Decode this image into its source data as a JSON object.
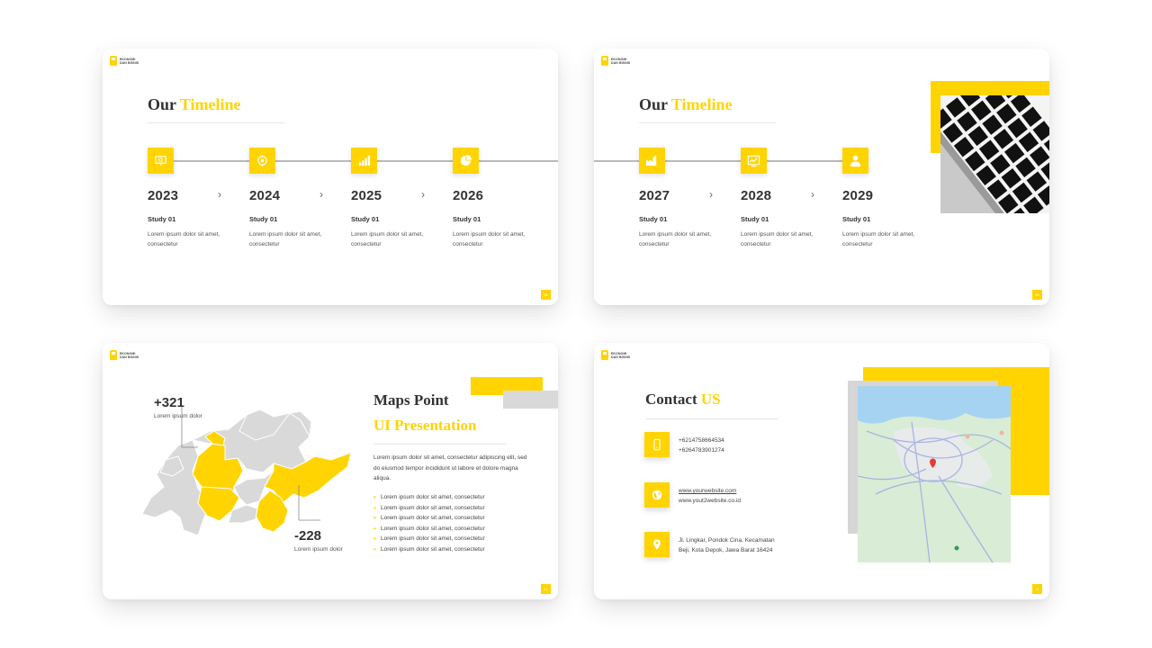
{
  "brand": {
    "logo_line1": "EKONOMI",
    "logo_line2": "DAN BISNIS",
    "primary": "#FFD400",
    "text": "#333333"
  },
  "slide1": {
    "title_main": "Our",
    "title_accent": "Timeline",
    "page": "08",
    "items": [
      {
        "year": "2023",
        "study": "Study 01",
        "desc": "Lorem ipsum dolor sit amet, consectetur",
        "icon": "presentation-icon"
      },
      {
        "year": "2024",
        "study": "Study 01",
        "desc": "Lorem ipsum dolor sit amet, consectetur",
        "icon": "target-icon"
      },
      {
        "year": "2025",
        "study": "Study 01",
        "desc": "Lorem ipsum dolor sit amet, consectetur",
        "icon": "bar-chart-icon"
      },
      {
        "year": "2026",
        "study": "Study 01",
        "desc": "Lorem ipsum dolor sit amet, consectetur",
        "icon": "pie-chart-icon"
      }
    ],
    "arrow": "›"
  },
  "slide2": {
    "title_main": "Our",
    "title_accent": "Timeline",
    "page": "09",
    "items": [
      {
        "year": "2027",
        "study": "Study 01",
        "desc": "Lorem ipsum dolor sit amet, consectetur",
        "icon": "factory-icon"
      },
      {
        "year": "2028",
        "study": "Study 01",
        "desc": "Lorem ipsum dolor sit amet, consectetur",
        "icon": "growth-board-icon"
      },
      {
        "year": "2029",
        "study": "Study 01",
        "desc": "Lorem ipsum dolor sit amet, consectetur",
        "icon": "person-icon"
      }
    ],
    "arrow": "›"
  },
  "slide3": {
    "stat1_value": "+321",
    "stat1_label": "Lorem ipsum dolor",
    "stat2_value": "-228",
    "stat2_label": "Lorem ipsum dolor",
    "title1": "Maps Point",
    "title2": "UI Presentation",
    "paragraph": "Lorem ipsum dolor sit amet, consectetur adipiscing elit, sed do eiusmod tempor incididunt ut labore et dolore magna aliqua.",
    "bullets": [
      "Lorem ipsum dolor sit amet, consectetur",
      "Lorem ipsum dolor sit amet, consectetur",
      "Lorem ipsum dolor sit amet, consectetur",
      "Lorem ipsum dolor sit amet, consectetur",
      "Lorem ipsum dolor sit amet, consectetur",
      "Lorem ipsum dolor sit amet, consectetur"
    ],
    "page": "10"
  },
  "slide4": {
    "title_main": "Contact",
    "title_accent": "US",
    "phone1": "+6214758664534",
    "phone2": "+6264783901274",
    "web1": "www.yourwebsite.com",
    "web2": "www.yout2website.co.id",
    "addr1": "Jl. Lingkar, Pondok Cina, Kecamatan",
    "addr2": "Beji, Kota Depok, Jawa Barat 16424",
    "page": "11"
  }
}
